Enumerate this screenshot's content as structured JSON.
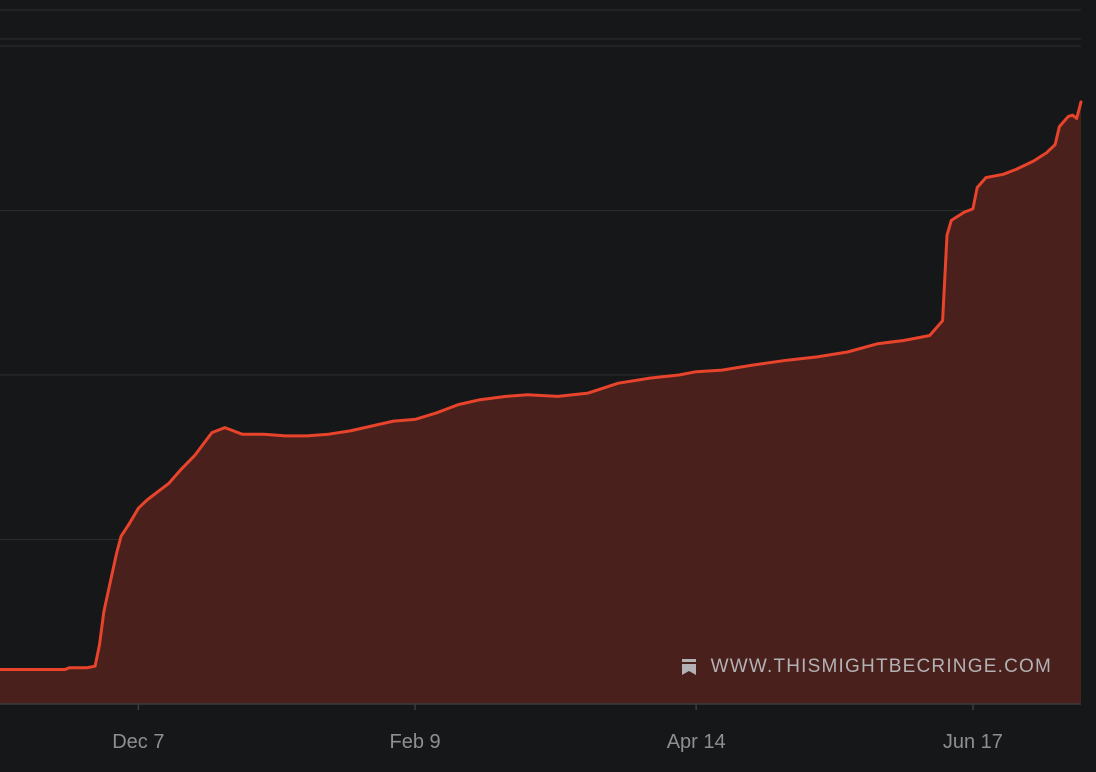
{
  "chart_data": {
    "type": "area",
    "x_tick_labels": [
      "Dec 7",
      "Feb 9",
      "Apr 14",
      "Jun 17"
    ],
    "x_ticks": [
      "2023-12-07",
      "2024-02-09",
      "2024-04-14",
      "2024-06-17"
    ],
    "x_range": [
      "2023-11-05",
      "2024-07-12"
    ],
    "y_range": [
      0,
      4.0
    ],
    "y_gridlines": [
      1,
      2,
      3,
      4
    ],
    "y_tick_labels": [],
    "grid": true,
    "legend": "none",
    "series": [
      {
        "points": [
          [
            "2023-11-05",
            0.21
          ],
          [
            "2023-11-13",
            0.21
          ],
          [
            "2023-11-20",
            0.21
          ],
          [
            "2023-11-21",
            0.22
          ],
          [
            "2023-11-25",
            0.22
          ],
          [
            "2023-11-27",
            0.23
          ],
          [
            "2023-11-28",
            0.36
          ],
          [
            "2023-11-29",
            0.56
          ],
          [
            "2023-11-30",
            0.68
          ],
          [
            "2023-12-02",
            0.92
          ],
          [
            "2023-12-03",
            1.02
          ],
          [
            "2023-12-05",
            1.1
          ],
          [
            "2023-12-07",
            1.19
          ],
          [
            "2023-12-09",
            1.24
          ],
          [
            "2023-12-12",
            1.3
          ],
          [
            "2023-12-14",
            1.34
          ],
          [
            "2023-12-17",
            1.43
          ],
          [
            "2023-12-20",
            1.51
          ],
          [
            "2023-12-22",
            1.58
          ],
          [
            "2023-12-24",
            1.65
          ],
          [
            "2023-12-27",
            1.68
          ],
          [
            "2023-12-29",
            1.66
          ],
          [
            "2023-12-31",
            1.64
          ],
          [
            "2024-01-05",
            1.64
          ],
          [
            "2024-01-10",
            1.63
          ],
          [
            "2024-01-15",
            1.63
          ],
          [
            "2024-01-20",
            1.64
          ],
          [
            "2024-01-25",
            1.66
          ],
          [
            "2024-01-30",
            1.69
          ],
          [
            "2024-02-04",
            1.72
          ],
          [
            "2024-02-09",
            1.73
          ],
          [
            "2024-02-14",
            1.77
          ],
          [
            "2024-02-19",
            1.82
          ],
          [
            "2024-02-24",
            1.85
          ],
          [
            "2024-03-01",
            1.87
          ],
          [
            "2024-03-06",
            1.88
          ],
          [
            "2024-03-13",
            1.87
          ],
          [
            "2024-03-20",
            1.89
          ],
          [
            "2024-03-27",
            1.95
          ],
          [
            "2024-04-03",
            1.98
          ],
          [
            "2024-04-10",
            2.0
          ],
          [
            "2024-04-14",
            2.02
          ],
          [
            "2024-04-20",
            2.03
          ],
          [
            "2024-04-27",
            2.06
          ],
          [
            "2024-05-05",
            2.09
          ],
          [
            "2024-05-12",
            2.11
          ],
          [
            "2024-05-19",
            2.14
          ],
          [
            "2024-05-26",
            2.19
          ],
          [
            "2024-06-01",
            2.21
          ],
          [
            "2024-06-07",
            2.24
          ],
          [
            "2024-06-10",
            2.33
          ],
          [
            "2024-06-11",
            2.85
          ],
          [
            "2024-06-12",
            2.94
          ],
          [
            "2024-06-15",
            2.99
          ],
          [
            "2024-06-17",
            3.01
          ],
          [
            "2024-06-18",
            3.14
          ],
          [
            "2024-06-20",
            3.2
          ],
          [
            "2024-06-24",
            3.22
          ],
          [
            "2024-06-27",
            3.25
          ],
          [
            "2024-07-01",
            3.3
          ],
          [
            "2024-07-04",
            3.35
          ],
          [
            "2024-07-06",
            3.4
          ],
          [
            "2024-07-07",
            3.51
          ],
          [
            "2024-07-09",
            3.57
          ],
          [
            "2024-07-10",
            3.58
          ],
          [
            "2024-07-11",
            3.56
          ],
          [
            "2024-07-12",
            3.66
          ]
        ]
      }
    ]
  },
  "colors": {
    "background": "#161719",
    "gridline": "#2c2d30",
    "axis": "#3b3c3f",
    "line": "#e8432b",
    "fill": "#4a201d"
  },
  "watermark": {
    "icon": "bookmark-icon",
    "text": "WWW.THISMIGHTBECRINGE.COM"
  }
}
